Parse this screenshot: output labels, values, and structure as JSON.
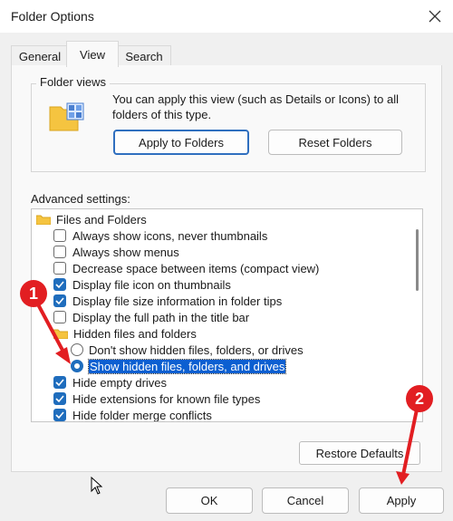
{
  "window": {
    "title": "Folder Options"
  },
  "tabs": [
    {
      "label": "General",
      "active": false
    },
    {
      "label": "View",
      "active": true
    },
    {
      "label": "Search",
      "active": false
    }
  ],
  "folder_views": {
    "legend": "Folder views",
    "description_line1": "You can apply this view (such as Details or Icons) to all",
    "description_line2": "folders of this type.",
    "apply_button": "Apply to Folders",
    "reset_button": "Reset Folders"
  },
  "advanced": {
    "label": "Advanced settings:",
    "tree": [
      {
        "type": "folder",
        "text": "Files and Folders"
      },
      {
        "type": "checkbox",
        "checked": false,
        "text": "Always show icons, never thumbnails"
      },
      {
        "type": "checkbox",
        "checked": false,
        "text": "Always show menus"
      },
      {
        "type": "checkbox",
        "checked": false,
        "text": "Decrease space between items (compact view)"
      },
      {
        "type": "checkbox",
        "checked": true,
        "text": "Display file icon on thumbnails"
      },
      {
        "type": "checkbox",
        "checked": true,
        "text": "Display file size information in folder tips"
      },
      {
        "type": "checkbox",
        "checked": false,
        "text": "Display the full path in the title bar"
      },
      {
        "type": "folder",
        "text": "Hidden files and folders"
      },
      {
        "type": "radio",
        "checked": false,
        "text": "Don't show hidden files, folders, or drives"
      },
      {
        "type": "radio",
        "checked": true,
        "selected": true,
        "text": "Show hidden files, folders, and drives"
      },
      {
        "type": "checkbox",
        "checked": true,
        "text": "Hide empty drives"
      },
      {
        "type": "checkbox",
        "checked": true,
        "text": "Hide extensions for known file types"
      },
      {
        "type": "checkbox",
        "checked": true,
        "text": "Hide folder merge conflicts"
      }
    ],
    "restore_button": "Restore Defaults"
  },
  "footer": {
    "ok": "OK",
    "cancel": "Cancel",
    "apply": "Apply"
  },
  "annotations": [
    {
      "label": "1"
    },
    {
      "label": "2"
    }
  ],
  "colors": {
    "accent": "#1f6dbd",
    "annotation": "#e21e22",
    "selection": "#0b5fd1"
  }
}
